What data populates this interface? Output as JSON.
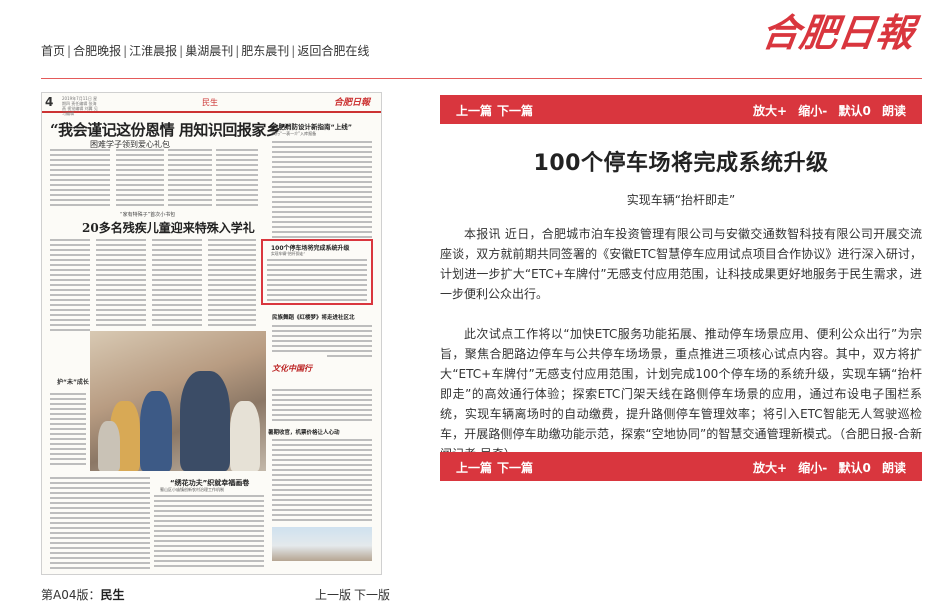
{
  "brand": {
    "logo_text": "合肥日報",
    "color": "#d9363e"
  },
  "topnav": {
    "items": [
      "首页",
      "合肥晚报",
      "江淮晨报",
      "巢湖晨刊",
      "肥东晨刊",
      "返回合肥在线"
    ],
    "separator": "|"
  },
  "newspaper": {
    "page_number": "4",
    "section": "民生",
    "date_block": "2019年7月11日 星期四 责任编辑 张海燕 视觉编辑 刘翼 见习编辑",
    "masthead": "合肥日報",
    "headline_main": "“我会谨记这份恩情  用知识回报家乡”",
    "headline_main_sub": "困难学子领到爱心礼包",
    "headline_right": "合肥消防设计新指南“上线”",
    "headline_right_sub": "实行“一表一介”入库报备",
    "headline_second_pre": "“家有特殊子”首次小书包",
    "headline_second": "20多名残疾儿童迎来特殊入学礼",
    "highlighted_headline": "100个停车场将完成系统升级",
    "highlighted_sub": "实现车辆“抬杆即走”",
    "headline_right_2": "民族舞蹈《红楼梦》将走进社区北",
    "photo_caption": "护“未”成长",
    "brand_insert": "文化中国行",
    "headline_right_3": "暑期收官，机票价格让人心动",
    "headline_bottom": "“绣花功夫”织就幸福画卷",
    "headline_bottom_sub": "蜀山区小庙镇创新农村治理工作机制"
  },
  "edition": {
    "label": "第A04版：",
    "name": "民生"
  },
  "pager": {
    "prev": "上一版",
    "next": "下一版"
  },
  "article_bar": {
    "prev": "上一篇",
    "next": "下一篇",
    "zoom_in": "放大+",
    "zoom_out": "缩小-",
    "default": "默认0",
    "read_aloud": "朗读"
  },
  "article": {
    "title": "100个停车场将完成系统升级",
    "subtitle": "实现车辆“抬杆即走”",
    "paragraphs": [
      "本报讯 近日，合肥城市泊车投资管理有限公司与安徽交通数智科技有限公司开展交流座谈，双方就前期共同签署的《安徽ETC智慧停车应用试点项目合作协议》进行深入研讨，计划进一步扩大“ETC+车牌付”无感支付应用范围，让科技成果更好地服务于民生需求，进一步便利公众出行。",
      "此次试点工作将以“加快ETC服务功能拓展、推动停车场景应用、便利公众出行”为宗旨，聚焦合肥路边停车与公共停车场场景，重点推进三项核心试点内容。其中，双方将扩大“ETC+车牌付”无感支付应用范围，计划完成100个停车场的系统升级，实现车辆“抬杆即走”的高效通行体验；探索ETC门架天线在路侧停车场景的应用，通过布设电子围栏系统，实现车辆离场时的自动缴费，提升路侧停车管理效率；将引入ETC智能无人驾驶巡检车，开展路侧停车助缴功能示范，探索“空地协同”的智慧交通管理新模式。（合肥日报-合新闻记者 吴奇）"
    ]
  }
}
